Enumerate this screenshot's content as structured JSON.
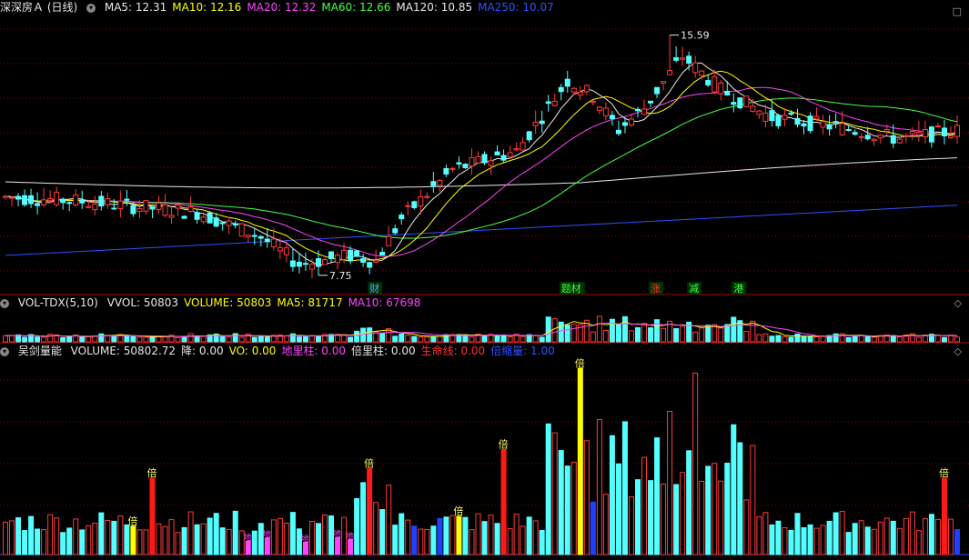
{
  "main_panel": {
    "title": "深深房Ａ (日线)",
    "indicators": [
      {
        "label": "MA5: 12.31",
        "color": "#e8e8e8"
      },
      {
        "label": "MA10: 12.16",
        "color": "#ffff00"
      },
      {
        "label": "MA20: 12.32",
        "color": "#ff44ff"
      },
      {
        "label": "MA60: 12.66",
        "color": "#44ff44"
      },
      {
        "label": "MA120: 10.85",
        "color": "#e8e8e8"
      },
      {
        "label": "MA250: 10.07",
        "color": "#3050ff"
      }
    ],
    "high_label": "15.59",
    "low_label": "7.75",
    "event_tags": [
      "财",
      "题材",
      "涨",
      "减",
      "港"
    ],
    "collapse_icon": "circle-chevron-icon",
    "window_icon": "square-icon"
  },
  "vol_panel": {
    "title": "VOL-TDX(5,10)",
    "indicators": [
      {
        "label": "VVOL: 50803",
        "color": "#e8e8e8"
      },
      {
        "label": "VOLUME: 50803",
        "color": "#ffff00"
      },
      {
        "label": "MA5: 81717",
        "color": "#ffff00"
      },
      {
        "label": "MA10: 67698",
        "color": "#ff44ff"
      }
    ]
  },
  "sword_panel": {
    "title": "吴剑量能",
    "indicators": [
      {
        "label": "VOLUME: 50802.72",
        "color": "#e8e8e8"
      },
      {
        "label": "降: 0.00",
        "color": "#e8e8e8"
      },
      {
        "label": "VO: 0.00",
        "color": "#ffff00"
      },
      {
        "label": "地里柱: 0.00",
        "color": "#ff44ff"
      },
      {
        "label": "倍里柱: 0.00",
        "color": "#e8e8e8"
      },
      {
        "label": "生命线: 0.00",
        "color": "#ff3030"
      },
      {
        "label": "倍缩量: 1.00",
        "color": "#3050ff"
      }
    ],
    "bei_tag": "倍",
    "di_tag": "地"
  },
  "colors": {
    "up": "#ff3a3a",
    "down": "#54ffff",
    "grid": "#8b0000",
    "ma5": "#e8e8e8",
    "ma10": "#ffff00",
    "ma20": "#ff44ff",
    "ma60": "#44ff44",
    "ma120": "#e8e8e8",
    "ma250": "#3050ff"
  }
}
